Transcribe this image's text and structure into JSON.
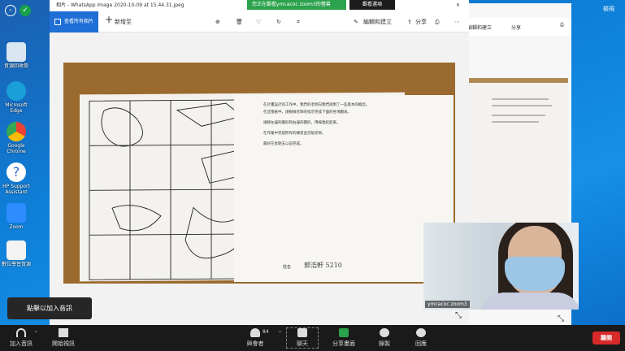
{
  "photos_window": {
    "title": "相片 - WhatsApp Image 2020-10-09 at 15.44.31.jpeg",
    "view_all": "查看所有相片",
    "add_to": "新增至",
    "edit_create": "編輯和建立",
    "share": "分享"
  },
  "second_window": {
    "edit_create": "編輯和建立",
    "share": "分享"
  },
  "share_banner": {
    "status": "您正在觀看ymcacoc zoom3的螢幕",
    "view_options": "觀看選項"
  },
  "video_tile": {
    "participant_name": "ymcacoc zoom3"
  },
  "tooltip": {
    "text": "點擊以加入音訊"
  },
  "right_tray": {
    "label": "檢視"
  },
  "document": {
    "lines": [
      "在計畫設計的工作中，我們的老師向我們說明了一些基本的概念。",
      "在這張紙中，請根據老師的指示完成下面的各項圖表。",
      "請將左邊的圖形和右邊的圖形，用線連結起來。",
      "在作業中完成所有的練習並交給老師。",
      "最好在星期五以前完成。"
    ],
    "name_label": "姓名",
    "signature": "郭浩軒 5210"
  },
  "zoom_toolbar": {
    "join_audio": "加入音訊",
    "start_video": "開始視訊",
    "participants": "與會者",
    "participants_count": "84",
    "chat": "聊天",
    "share_screen": "分享畫面",
    "record": "錄製",
    "reactions": "回應",
    "end": "離開"
  },
  "desktop_icons": [
    {
      "label": "資源回收筒",
      "color": "#d9e6f2"
    },
    {
      "label": "Microsoft Edge",
      "color": "#1aa0d8"
    },
    {
      "label": "Google Chrome",
      "color": "#e94235"
    },
    {
      "label": "HP Support Assistant",
      "color": "#2a66c9"
    },
    {
      "label": "Zoom",
      "color": "#2d8cff"
    },
    {
      "label": "數位學習資源",
      "color": "#f3f3f3"
    }
  ]
}
